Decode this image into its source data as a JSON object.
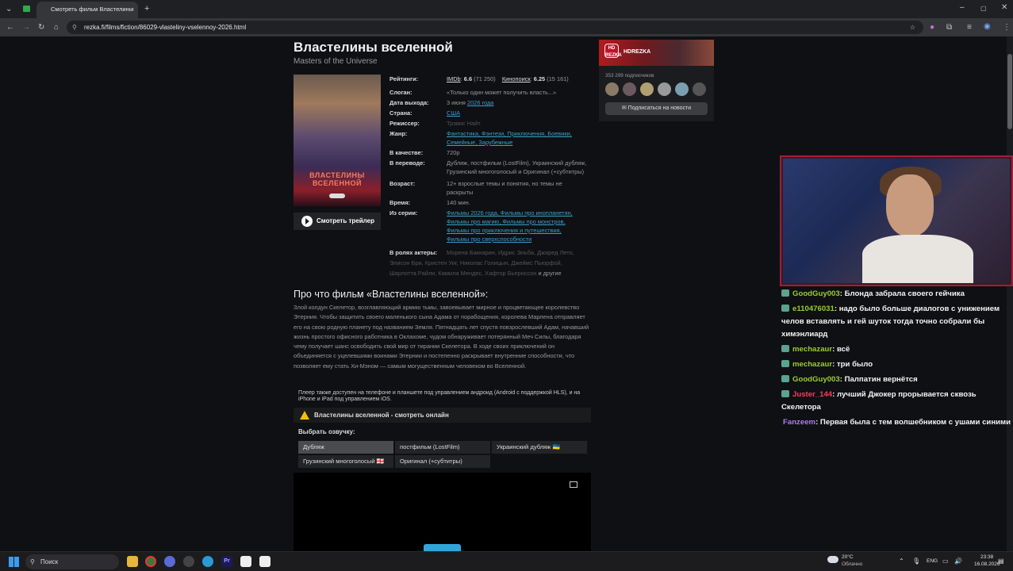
{
  "browser": {
    "tab_title": "Смотреть фильм Властелины",
    "new_tab": "+",
    "url": "rezka.fi/films/fiction/86029-vlasteliny-vselennoy-2026.html"
  },
  "film": {
    "title": "Властелины вселенной",
    "original_title": "Masters of the Universe",
    "poster_title": "ВЛАСТЕЛИНЫ ВСЕЛЕННОЙ",
    "trailer_button": "Смотреть трейлер",
    "info": {
      "ratings_label": "Рейтинги:",
      "imdb_label": "IMDb",
      "imdb_score": "6.6",
      "imdb_votes": "(71 250)",
      "kp_label": "Кинопоиск",
      "kp_score": "6.25",
      "kp_votes": "(15 161)",
      "slogan_label": "Слоган:",
      "slogan": "«Только один может получить власть...»",
      "release_label": "Дата выхода:",
      "release_day": "3 июня",
      "release_year": "2026 года",
      "country_label": "Страна:",
      "country": "США",
      "director_label": "Режиссер:",
      "director": "Трэвис Найт",
      "genre_label": "Жанр:",
      "genres_line1": "Фантастика, Фэнтези, Приключения, Боевики,",
      "genres_line2": "Семейные, Зарубежные",
      "quality_label": "В качестве:",
      "quality": "720p",
      "translation_label": "В переводе:",
      "translation": "Дубляж, постфильм (LostFilm), Украинский дубляж, Грузинский многоголосый и Оригинал (+субтитры)",
      "age_label": "Возраст:",
      "age": "12+ взрослые темы и понятия, но темы не раскрыты",
      "time_label": "Время:",
      "time": "140 мин.",
      "series_label": "Из серии:",
      "series_1": "Фильмы 2026 года, Фильмы про инопланетян,",
      "series_2": "Фильмы про магию, Фильмы про монстров,",
      "series_3": "Фильмы про приключения и путешествия,",
      "series_4": "Фильмы про сверхспособности",
      "actors_label": "В ролях актеры:",
      "actors_1": "Морена Баккарин, Идрис Эльба, Джаред Лето,",
      "actors_2": "Элисон Бри, Кристен Уиг, Николас Голицын, Джеймс Пьюрфой,",
      "actors_3": "Шарлотта Райли, Камила Мендес, Хафтор Бьернссон",
      "actors_more": "и другие"
    },
    "about_heading": "Про что фильм «Властелины вселенной»:",
    "description": "Злой колдун Скелетор, возглавляющий армию тьмы, завоевывает мирное и процветающее королевство Этерния. Чтобы защитить своего маленького сына Адама от порабощения, королева Марлена отправляет его на свою родную планету под названием Земля. Пятнадцать лет спустя повзрослевший Адам, начавший жизнь простого офисного работника в Оклахоме, чудом обнаруживает потерянный Меч Силы, благодаря чему получает шанс освободить свой мир от тирании Скелетора. В ходе своих приключений он объединяется с уцелевшими воинами Этернии и постепенно раскрывает внутренние способности, что позволяет ему стать Хи-Мэном — самым могущественным человеком во Вселенной.",
    "player_note": "Плеер также доступен на телефоне и планшете под управлением андроид (Android с поддержкой HLS), и на iPhone и iPad под управлением iOS.",
    "player_title": "Властелины вселенной - смотреть онлайн",
    "choose_voice": "Выбрать озвучку:",
    "translators": [
      "Дубляж",
      "постфильм (LostFilm)",
      "Украинский дубляж 🇺🇦",
      "Грузинский многоголосый 🇬🇪",
      "Оригинал (+субтитры)"
    ]
  },
  "vk": {
    "logo": "HD REZKA",
    "name": "HDREZKA",
    "subscribers": "353 299 подписчиков",
    "subscribe": "Подписаться на новости"
  },
  "chat": [
    {
      "user": "GoodGuy003",
      "color": "#9acd32",
      "text": ": Блонда забрала своего гейчика"
    },
    {
      "user": "e110476031",
      "color": "#9acd32",
      "text": ": надо было больше диалогов с унижением челов вставлять и гей шуток тогда точно собрали бы химэнлиард"
    },
    {
      "user": "mechazaur",
      "color": "#9acd32",
      "text": ": всё"
    },
    {
      "user": "mechazaur",
      "color": "#9acd32",
      "text": ": три было"
    },
    {
      "user": "GoodGuy003",
      "color": "#9acd32",
      "text": ": Палпатин вернётся"
    },
    {
      "user": "Juster_144",
      "color": "#ff3b5c",
      "text": ": лучший Джокер прорывается сквозь Скелетора"
    },
    {
      "user": "Fanzeem",
      "color": "#b07cf0",
      "text": ": Первая была с тем волшебником с ушами синими"
    }
  ],
  "taskbar": {
    "search": "Поиск",
    "weather_temp": "20°C",
    "weather_desc": "Облачно",
    "lang": "ENG",
    "time": "23:38",
    "date": "16.08.2026"
  }
}
